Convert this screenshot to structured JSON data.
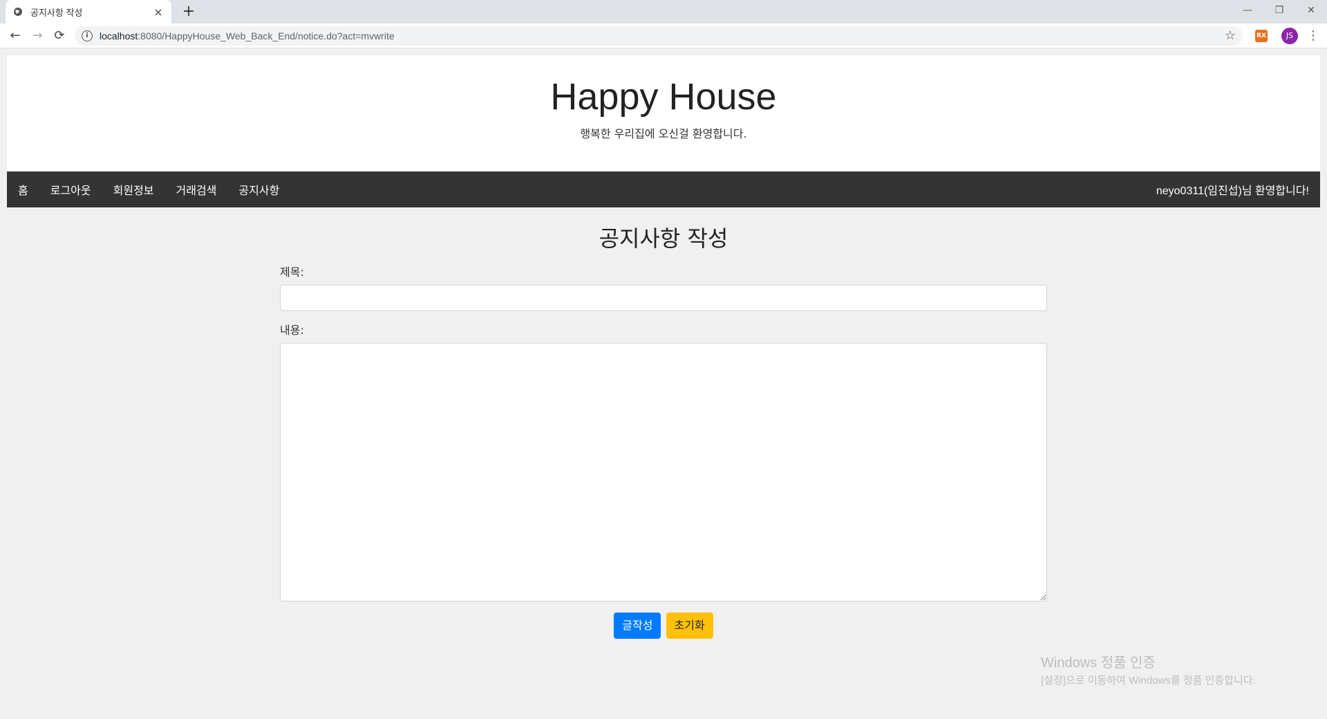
{
  "browser": {
    "tab_title": "공지사항 작성",
    "tab_close": "×",
    "new_tab": "+",
    "url_host": "localhost",
    "url_path": ":8080/HappyHouse_Web_Back_End/notice.do?act=mvwrite",
    "profile_initials": "JS",
    "extension_label": "RX",
    "window_controls": {
      "minimize": "—",
      "restore": "❐",
      "close": "✕"
    },
    "nav": {
      "back": "←",
      "forward": "→",
      "reload": "⟳",
      "star": "☆",
      "menu": "⋮"
    }
  },
  "header": {
    "title": "Happy House",
    "subtitle": "행복한 우리집에 오신걸 환영합니다."
  },
  "navbar": {
    "items": [
      {
        "label": "홈"
      },
      {
        "label": "로그아웃"
      },
      {
        "label": "회원정보"
      },
      {
        "label": "거래검색"
      },
      {
        "label": "공지사항"
      }
    ],
    "welcome": "neyo0311(임진섭)님 환영합니다!"
  },
  "form": {
    "heading": "공지사항 작성",
    "subject_label": "제목:",
    "subject_value": "",
    "content_label": "내용:",
    "content_value": "",
    "submit_label": "글작성",
    "reset_label": "초기화"
  },
  "watermark": {
    "line1": "Windows 정품 인증",
    "line2": "[설정]으로 이동하여 Windows를 정품 인증합니다."
  },
  "colors": {
    "navbar_bg": "#343434",
    "primary": "#007bff",
    "warning": "#ffc107",
    "page_bg": "#f0f0f0"
  }
}
